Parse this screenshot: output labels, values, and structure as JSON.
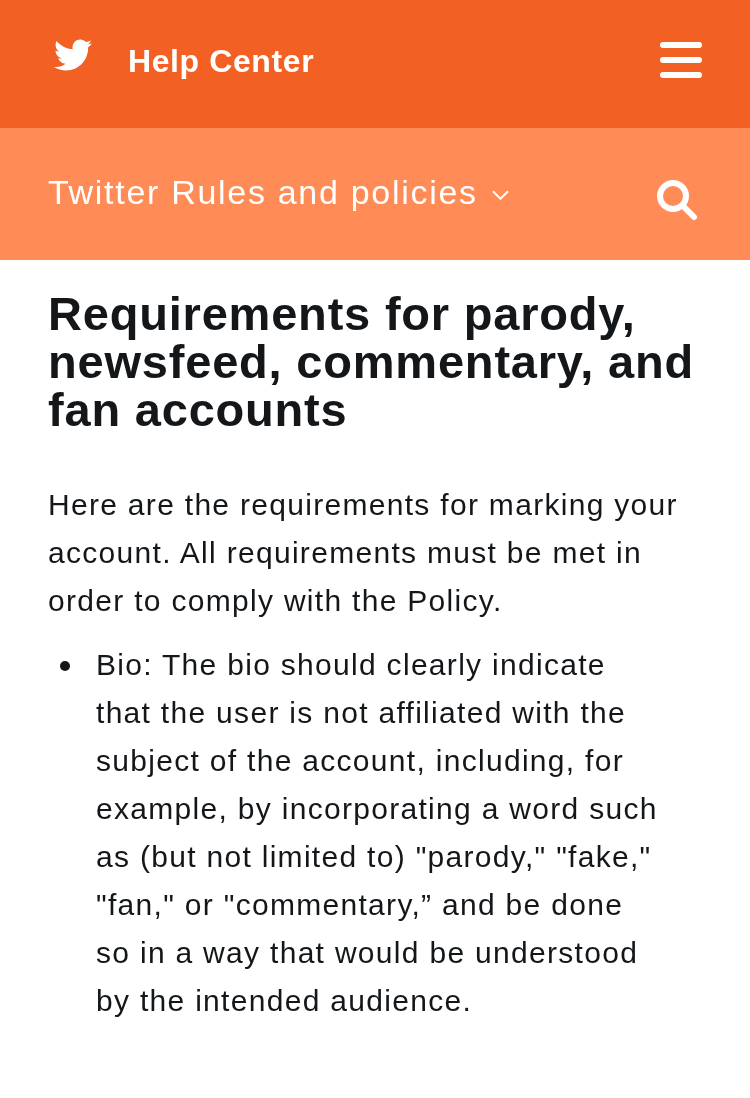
{
  "header": {
    "title": "Help Center"
  },
  "subnav": {
    "label": "Twitter Rules and policies"
  },
  "article": {
    "heading": "Requirements for parody, newsfeed, commentary, and fan accounts",
    "intro": "Here are the requirements for marking your account. All requirements must be met in order to comply with the Policy.",
    "bullets": [
      "Bio: The bio should clearly indicate that the user is not affiliated with the subject of the account, including, for example, by incorporating a word such as (but not limited to) \"parody,\" \"fake,\" \"fan,\" or \"commentary,” and be done so in a way that would be understood by the intended audience."
    ]
  }
}
